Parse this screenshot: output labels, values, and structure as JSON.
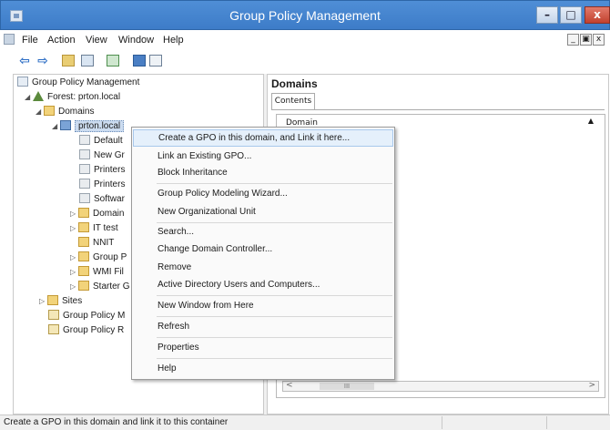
{
  "window": {
    "title": "Group Policy Management",
    "min_glyph": "–",
    "max_glyph": "□",
    "close_glyph": "x"
  },
  "menubar": {
    "items": [
      "File",
      "Action",
      "View",
      "Window",
      "Help"
    ],
    "mdi_min": "_",
    "mdi_restore": "▣",
    "mdi_close": "x"
  },
  "toolbar": {
    "back_glyph": "⇦",
    "forward_glyph": "⇨"
  },
  "tree": [
    {
      "label": "Group Policy Management",
      "expander": "",
      "icon": "console-root-icon"
    },
    {
      "label": "Forest: prton.local",
      "expander": "◢",
      "icon": "forest-icon"
    },
    {
      "label": "Domains",
      "expander": "◢",
      "icon": "domains-folder-icon"
    },
    {
      "label": "prton.local",
      "expander": "◢",
      "icon": "domain-icon"
    },
    {
      "label": "Default",
      "expander": "",
      "icon": "gpo-link-icon"
    },
    {
      "label": "New Gr",
      "expander": "",
      "icon": "gpo-link-icon"
    },
    {
      "label": "Printers",
      "expander": "",
      "icon": "gpo-link-icon"
    },
    {
      "label": "Printers",
      "expander": "",
      "icon": "gpo-link-icon"
    },
    {
      "label": "Softwar",
      "expander": "",
      "icon": "gpo-link-icon"
    },
    {
      "label": "Domain",
      "expander": "▷",
      "icon": "ou-folder-icon"
    },
    {
      "label": "IT test",
      "expander": "▷",
      "icon": "ou-folder-icon"
    },
    {
      "label": "NNIT",
      "expander": "",
      "icon": "ou-folder-icon"
    },
    {
      "label": "Group P",
      "expander": "▷",
      "icon": "gpo-folder-icon"
    },
    {
      "label": "WMI Fil",
      "expander": "▷",
      "icon": "wmi-folder-icon"
    },
    {
      "label": "Starter G",
      "expander": "▷",
      "icon": "starter-folder-icon"
    },
    {
      "label": "Sites",
      "expander": "▷",
      "icon": "sites-folder-icon"
    },
    {
      "label": "Group Policy M",
      "expander": "",
      "icon": "modeling-icon"
    },
    {
      "label": "Group Policy R",
      "expander": "",
      "icon": "results-icon"
    }
  ],
  "right_pane": {
    "title": "Domains",
    "tab": "Contents",
    "column_header": "Domain",
    "sort_glyph": "▲",
    "scroll_left": "<",
    "scroll_right": ">",
    "scroll_thumb": "III"
  },
  "context_menu": {
    "items": [
      "Create a GPO in this domain, and Link it here...",
      "Link an Existing GPO...",
      "Block Inheritance",
      "Group Policy Modeling Wizard...",
      "New Organizational Unit",
      "Search...",
      "Change Domain Controller...",
      "Remove",
      "Active Directory Users and Computers...",
      "New Window from Here",
      "Refresh",
      "Properties",
      "Help"
    ],
    "highlighted_index": 0
  },
  "statusbar": {
    "text": "Create a GPO in this domain and link it to this container"
  }
}
